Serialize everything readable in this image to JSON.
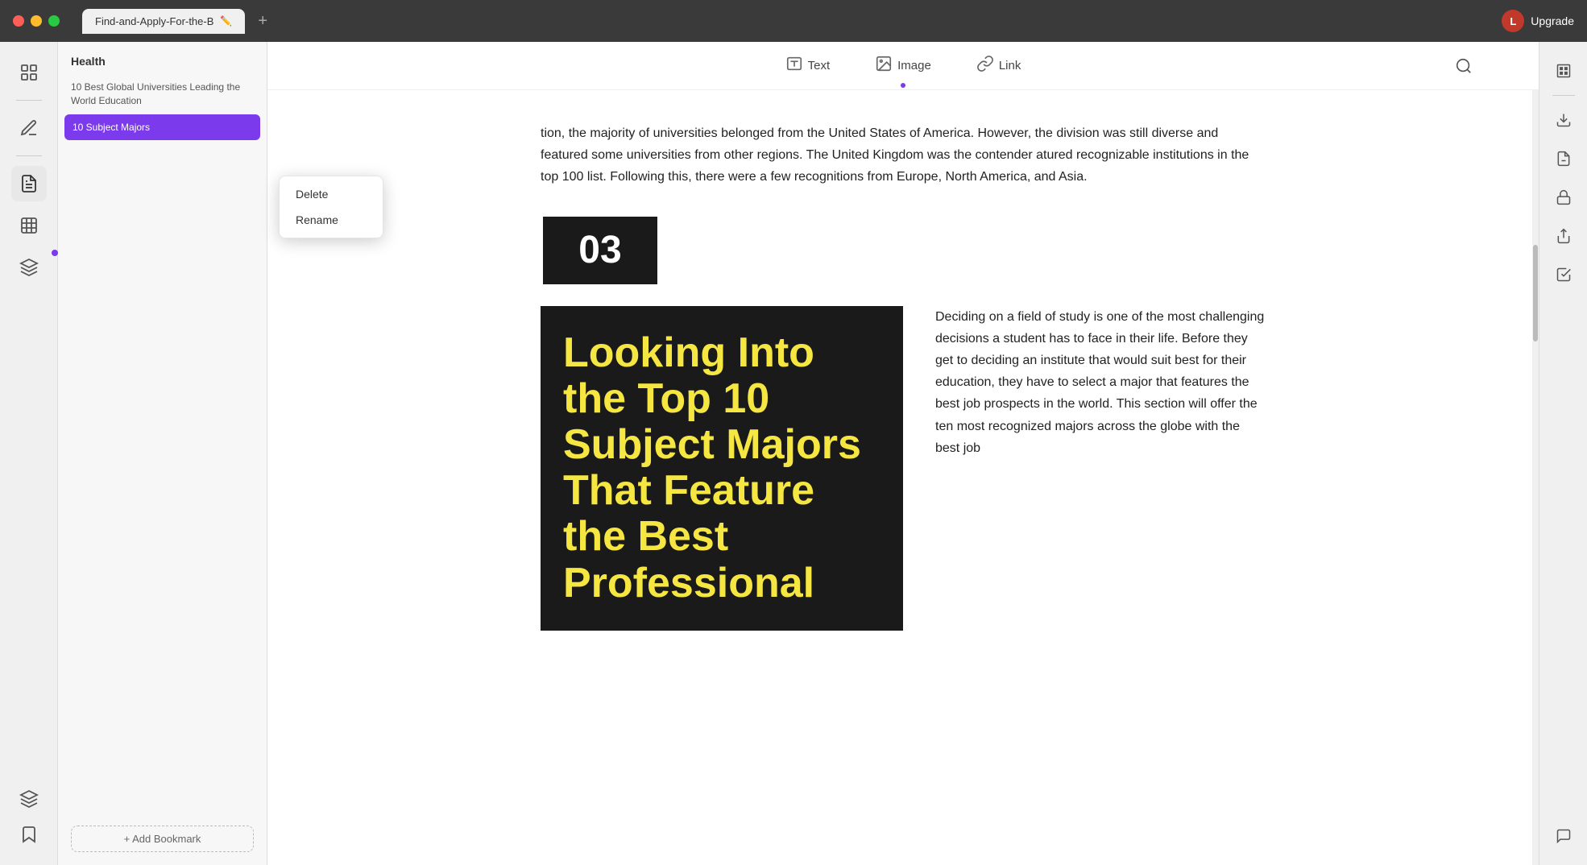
{
  "titlebar": {
    "tab_label": "Find-and-Apply-For-the-B",
    "upgrade_label": "Upgrade",
    "upgrade_avatar": "L"
  },
  "toolbar": {
    "text_label": "Text",
    "image_label": "Image",
    "link_label": "Link"
  },
  "sidebar": {
    "bookmarks_header": "Health",
    "bookmark_items": [
      {
        "label": "10 Best Global Universities Leading the World Education",
        "active": false
      },
      {
        "label": "10 Subject Majors",
        "active": true
      }
    ],
    "add_bookmark_label": "+ Add Bookmark"
  },
  "context_menu": {
    "items": [
      "Delete",
      "Rename"
    ]
  },
  "content": {
    "paragraph1": "tion, the majority of universities belonged from the United States of America. However, the division was still diverse and featured some universities from other regions. The United Kingdom was the contender atured recognizable institutions in the top 100 list. Following this, there were a few recognitions from Europe, North America, and Asia.",
    "image_number": "03",
    "image_title": "Looking Into the Top 10 Subject Majors That Feature the Best Professional",
    "right_text": "Deciding on a field of study is one of the most challenging decisions a student has to face in their life. Before they get to deciding an institute that would suit best for their education, they have to select a major that features the best job prospects in the world. This section will offer the ten most recognized majors across the globe with the best job"
  },
  "right_panel": {
    "icons": [
      "ocr",
      "extract",
      "pdf-a",
      "lock",
      "share",
      "check",
      "chat"
    ]
  }
}
